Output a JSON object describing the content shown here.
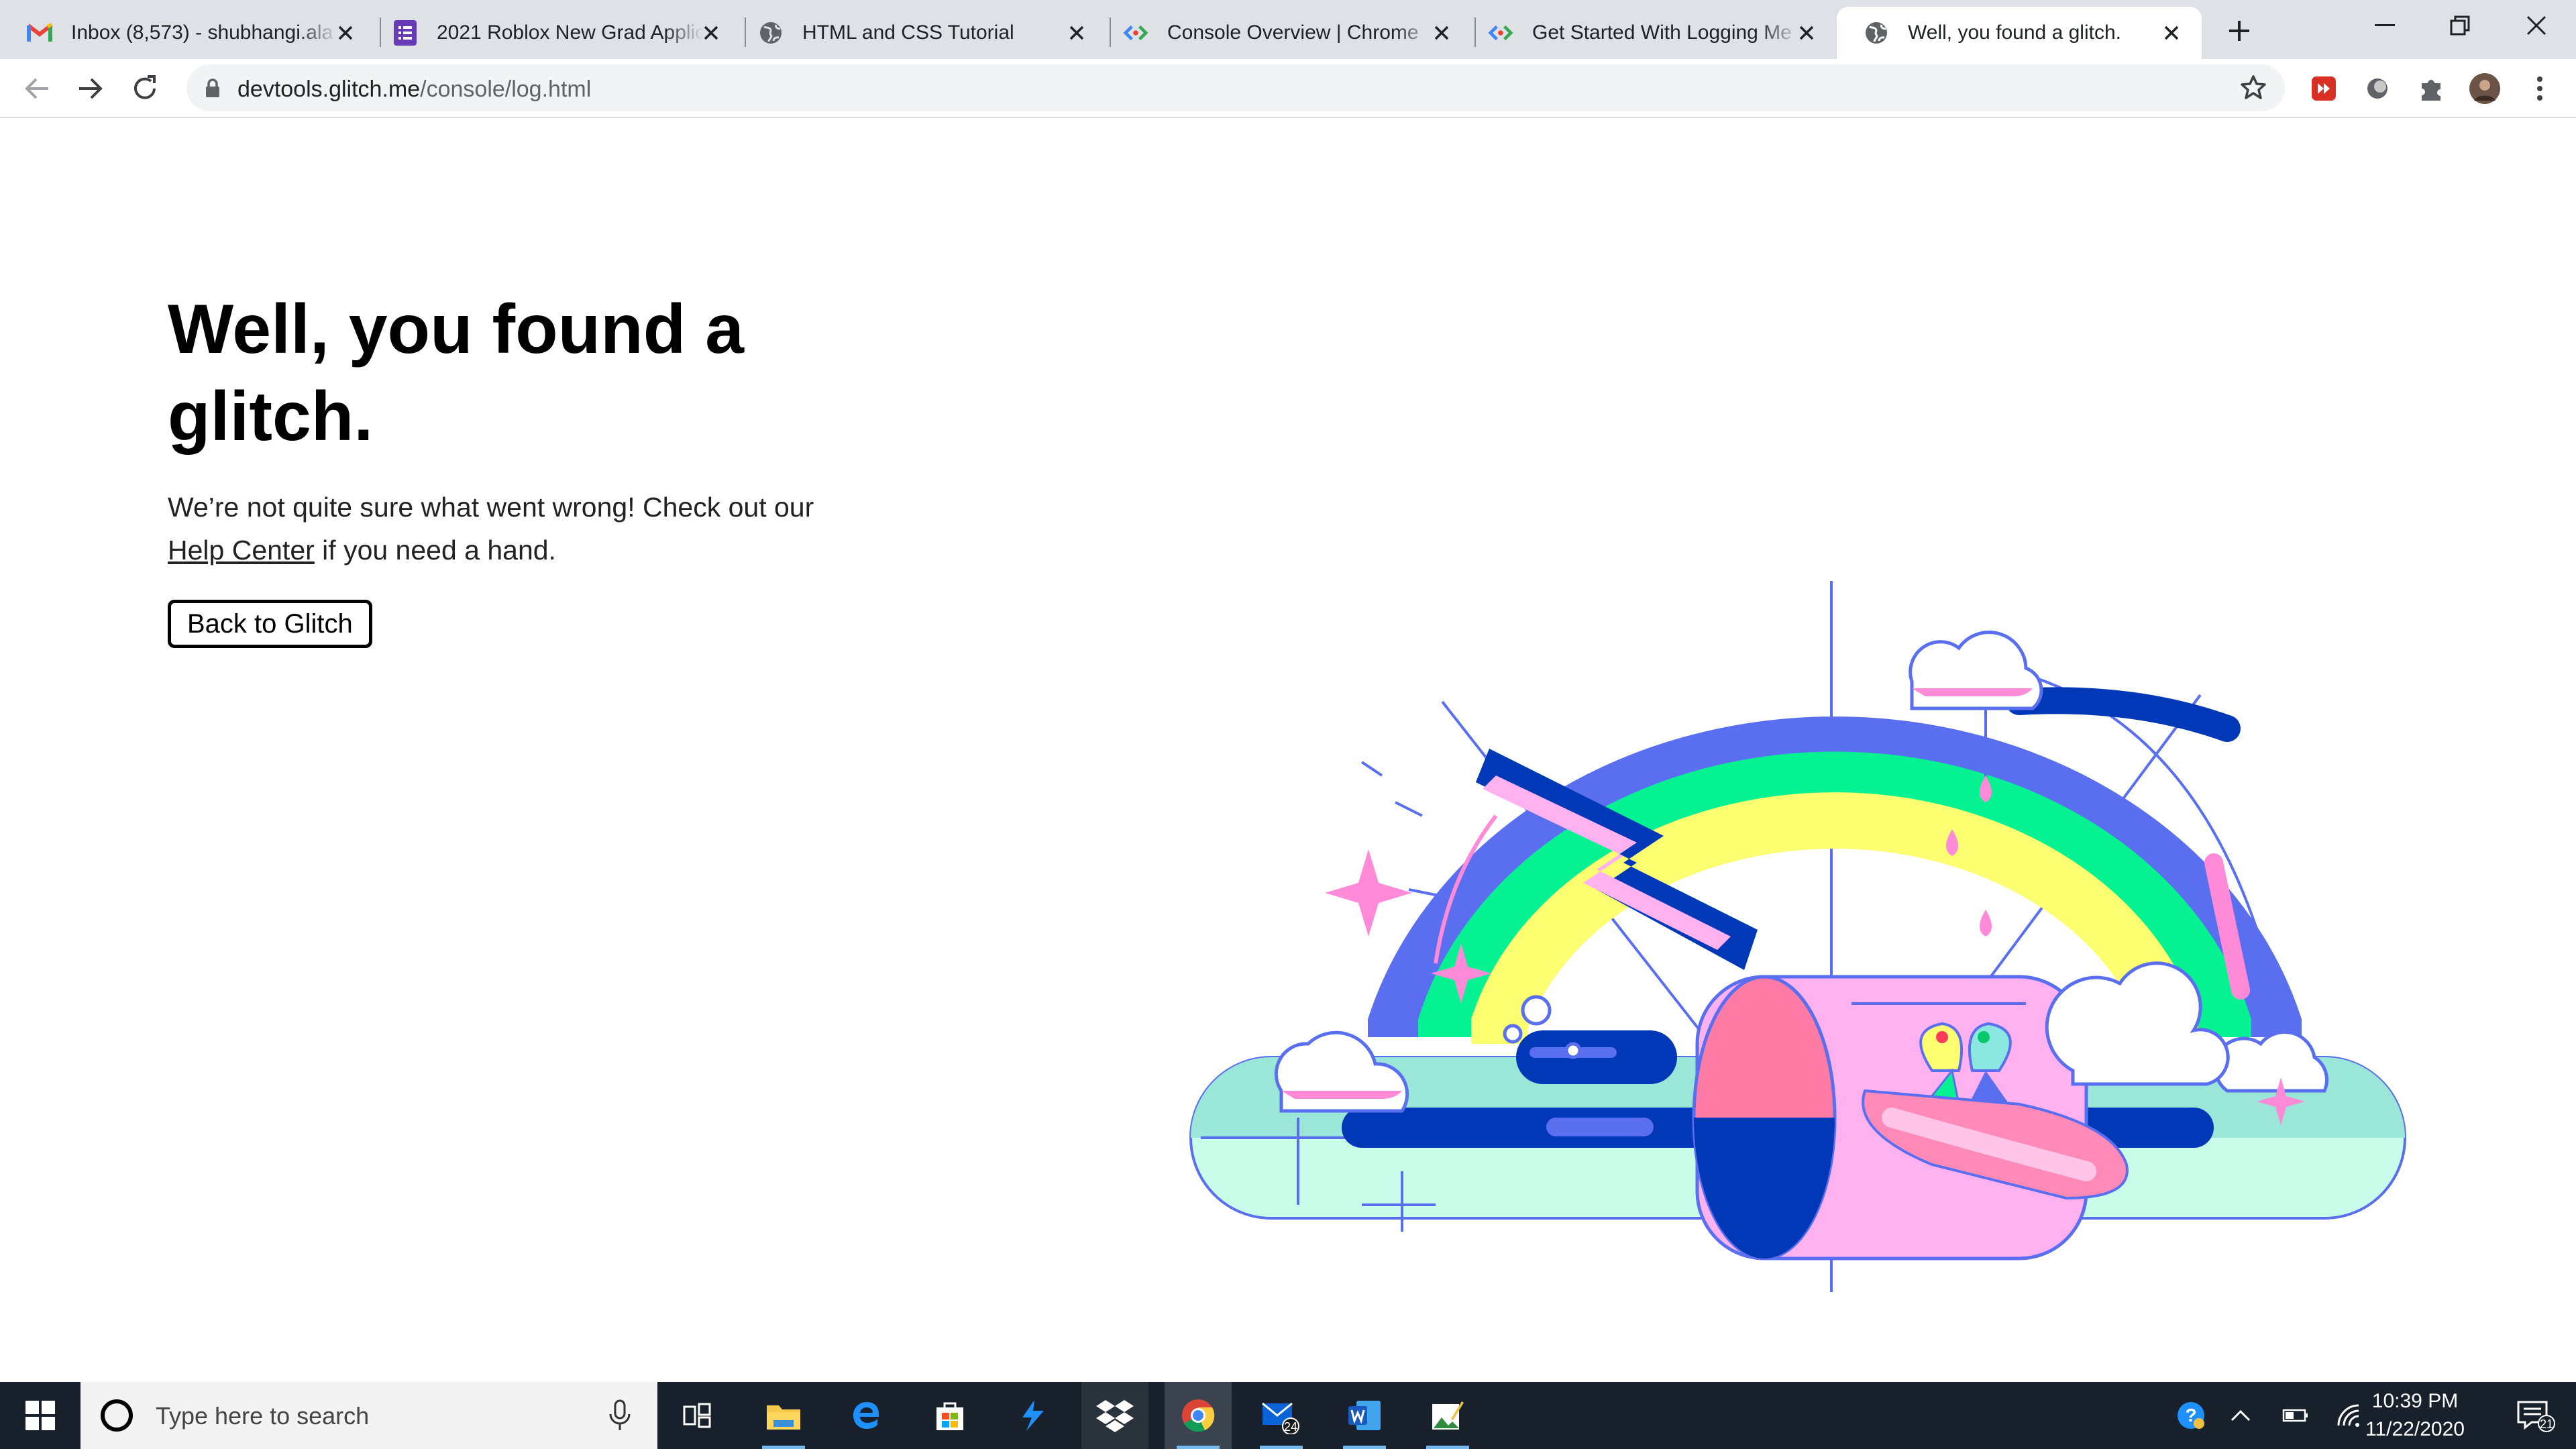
{
  "browser": {
    "tabs": [
      {
        "title": "Inbox (8,573) - shubhangi.ala",
        "favicon": "gmail-icon",
        "active": false
      },
      {
        "title": "2021 Roblox New Grad Applic",
        "favicon": "forms-icon",
        "active": false
      },
      {
        "title": "HTML and CSS Tutorial",
        "favicon": "globe-icon",
        "active": false
      },
      {
        "title": "Console Overview | Chrome",
        "favicon": "devtools-icon",
        "active": false
      },
      {
        "title": "Get Started With Logging Me",
        "favicon": "devtools-icon",
        "active": false
      },
      {
        "title": "Well, you found a glitch.",
        "favicon": "globe-icon",
        "active": true
      }
    ],
    "address": {
      "host": "devtools.glitch.me",
      "path": "/console/log.html"
    }
  },
  "page": {
    "heading": "Well, you found a glitch.",
    "message_before": "We’re not quite sure what went wrong! Check out our ",
    "help_link": "Help Center",
    "message_after": " if you need a hand.",
    "back_button": "Back to Glitch"
  },
  "taskbar": {
    "search_placeholder": "Type here to search",
    "mail_badge": "24",
    "notification_badge": "21",
    "time": "10:39 PM",
    "date": "11/22/2020"
  },
  "colors": {
    "illustration_blue": "#5a6ff0",
    "illustration_green": "#05f293",
    "illustration_yellow": "#fbff70",
    "illustration_pink": "#ff7aa4",
    "illustration_navy": "#0038b8",
    "taskbar_bg": "#18202b"
  }
}
